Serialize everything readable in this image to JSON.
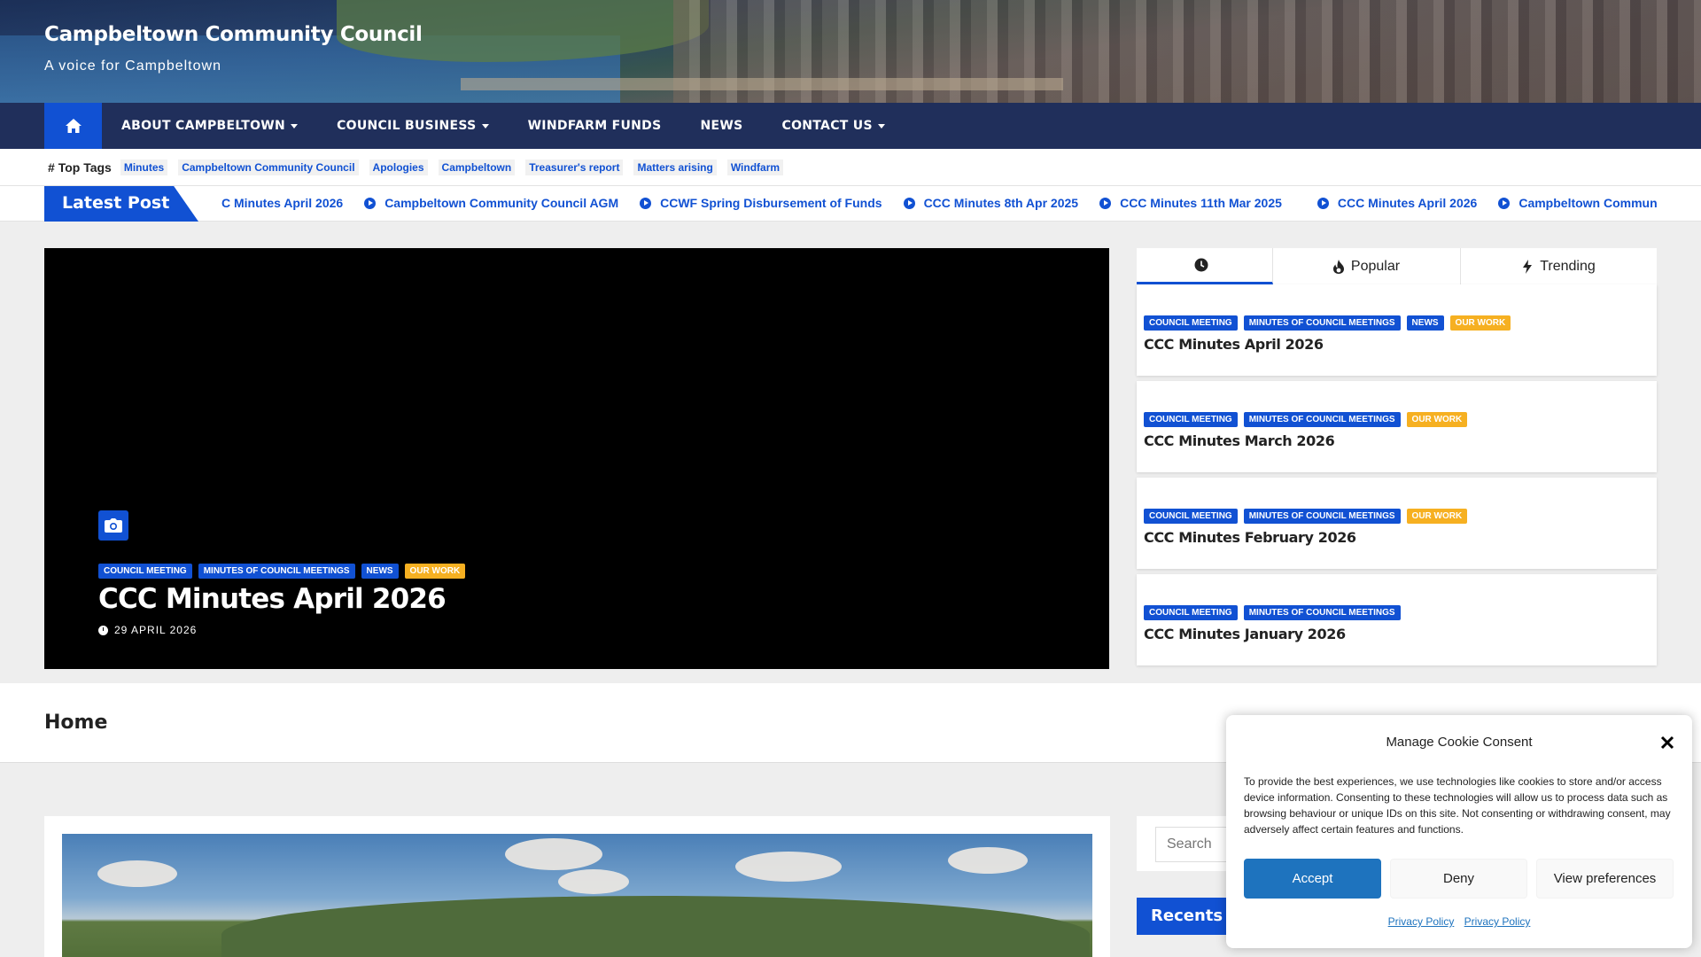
{
  "site": {
    "title": "Campbeltown Community Council",
    "tagline": "A voice for Campbeltown"
  },
  "nav": {
    "home_icon": "home-icon",
    "items": [
      {
        "label": "ABOUT CAMPBELTOWN",
        "dropdown": true
      },
      {
        "label": "COUNCIL BUSINESS",
        "dropdown": true
      },
      {
        "label": "WINDFARM FUNDS",
        "dropdown": false
      },
      {
        "label": "NEWS",
        "dropdown": false
      },
      {
        "label": "CONTACT US",
        "dropdown": true
      }
    ]
  },
  "top_tags": {
    "label": "Top Tags",
    "tags": [
      "Minutes",
      "Campbeltown Community Council",
      "Apologies",
      "Campbeltown",
      "Treasurer's report",
      "Matters arising",
      "Windfarm"
    ]
  },
  "latest_post": {
    "label": "Latest Post",
    "items": [
      "C Minutes April 2026",
      "Campbeltown Community Council AGM",
      "CCWF Spring Disbursement of Funds",
      "CCC Minutes 8th Apr 2025",
      "CCC Minutes 11th Mar 2025",
      "CCC Minutes April 2026",
      "Campbeltown Communi"
    ]
  },
  "featured": {
    "categories": [
      "COUNCIL MEETING",
      "MINUTES OF COUNCIL MEETINGS",
      "NEWS",
      "OUR WORK"
    ],
    "title": "CCC Minutes April 2026",
    "date": "29 APRIL 2026"
  },
  "tabs": {
    "recent_icon": "clock-icon",
    "popular_label": "Popular",
    "trending_label": "Trending"
  },
  "tab_posts": [
    {
      "categories": [
        "COUNCIL MEETING",
        "MINUTES OF COUNCIL MEETINGS",
        "NEWS",
        "OUR WORK"
      ],
      "title": "CCC Minutes April 2026"
    },
    {
      "categories": [
        "COUNCIL MEETING",
        "MINUTES OF COUNCIL MEETINGS",
        "OUR WORK"
      ],
      "title": "CCC Minutes March 2026"
    },
    {
      "categories": [
        "COUNCIL MEETING",
        "MINUTES OF COUNCIL MEETINGS",
        "OUR WORK"
      ],
      "title": "CCC Minutes February 2026"
    },
    {
      "categories": [
        "COUNCIL MEETING",
        "MINUTES OF COUNCIL MEETINGS"
      ],
      "title": "CCC Minutes January 2026"
    }
  ],
  "page": {
    "title": "Home"
  },
  "sidebar": {
    "search_placeholder": "Search",
    "recent_title": "Recents P"
  },
  "cookie": {
    "title": "Manage Cookie Consent",
    "text": "To provide the best experiences, we use technologies like cookies to store and/or access device information. Consenting to these technologies will allow us to process data such as browsing behaviour or unique IDs on this site. Not consenting or withdrawing consent, may adversely affect certain features and functions.",
    "accept": "Accept",
    "deny": "Deny",
    "preferences": "View preferences",
    "link1": "Privacy Policy",
    "link2": "Privacy Policy"
  },
  "colors": {
    "primary": "#1151d3",
    "nav_bg": "#202f5b",
    "orange": "#f6b021",
    "cookie_accept": "#1e73be"
  }
}
